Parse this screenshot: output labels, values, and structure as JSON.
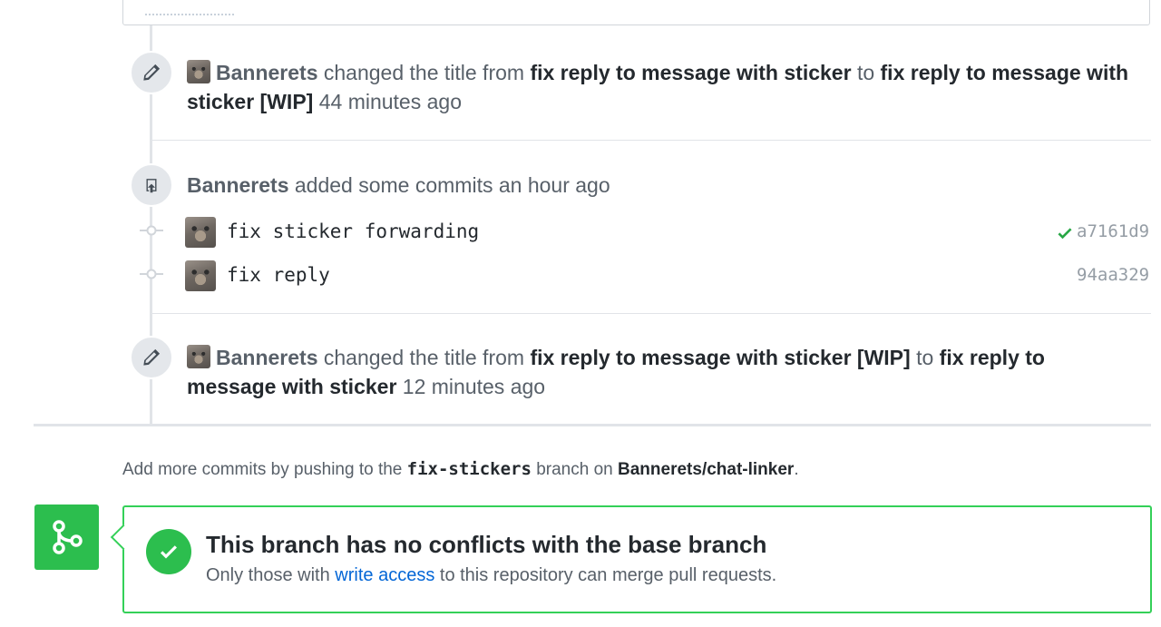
{
  "timeline": {
    "title_change_1": {
      "author": "Bannerets",
      "action": "changed the title from",
      "old_title": "fix reply to message with sticker",
      "joiner": "to",
      "new_title": "fix reply to message with sticker [WIP]",
      "time": "44 minutes ago"
    },
    "commits_event": {
      "author": "Bannerets",
      "action": "added some commits",
      "time": "an hour ago",
      "commits": [
        {
          "message": "fix sticker forwarding",
          "sha": "a7161d9",
          "status": "success"
        },
        {
          "message": "fix reply",
          "sha": "94aa329",
          "status": ""
        }
      ]
    },
    "title_change_2": {
      "author": "Bannerets",
      "action": "changed the title from",
      "old_title": "fix reply to message with sticker [WIP]",
      "joiner": "to",
      "new_title": "fix reply to message with sticker",
      "time": "12 minutes ago"
    }
  },
  "push_note": {
    "prefix": "Add more commits by pushing to the",
    "branch": "fix-stickers",
    "middle": "branch on",
    "repo": "Bannerets/chat-linker",
    "suffix": "."
  },
  "merge_status": {
    "title": "This branch has no conflicts with the base branch",
    "sub_prefix": "Only those with",
    "sub_link": "write access",
    "sub_suffix": "to this repository can merge pull requests."
  },
  "icons": {
    "pencil": "pencil-icon",
    "repo_push": "repo-push-icon",
    "commit": "git-commit-icon",
    "check": "check-icon",
    "merge": "git-merge-icon"
  },
  "colors": {
    "success": "#2cbe4e",
    "link": "#0366d6",
    "muted": "#586069"
  }
}
